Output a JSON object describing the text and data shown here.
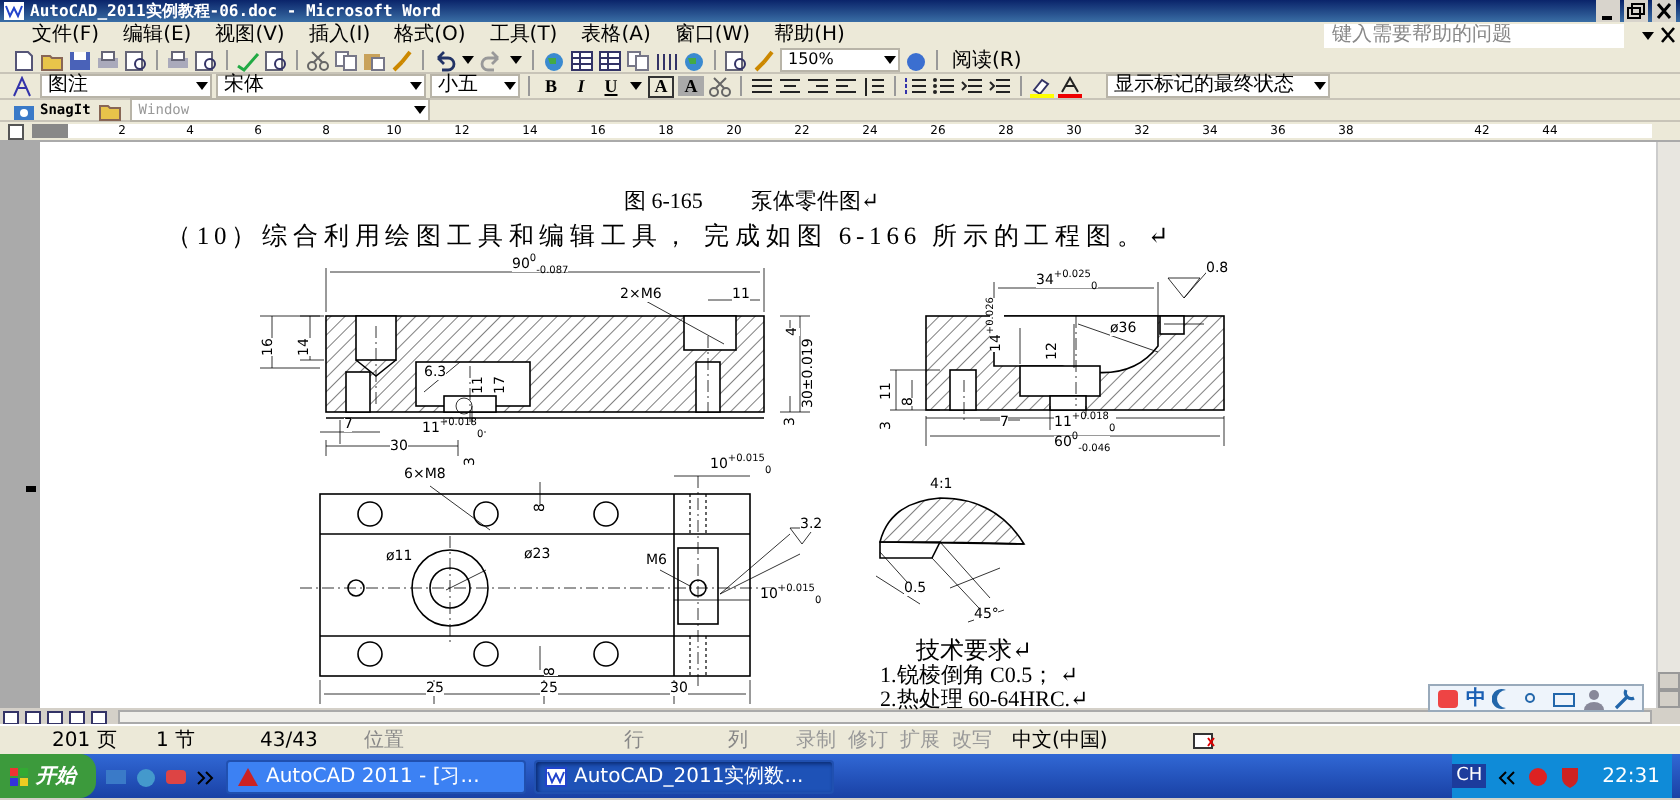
{
  "window": {
    "title": "AutoCAD_2011实例教程-06.doc - Microsoft Word"
  },
  "menu": [
    "文件(F)",
    "编辑(E)",
    "视图(V)",
    "插入(I)",
    "格式(O)",
    "工具(T)",
    "表格(A)",
    "窗口(W)",
    "帮助(H)"
  ],
  "help_box": {
    "placeholder": "键入需要帮助的问题"
  },
  "standard_toolbar": {
    "zoom": "150%",
    "read_button": "阅读(R)"
  },
  "format_toolbar": {
    "style": "图注",
    "font": "宋体",
    "size": "小五",
    "buttons": [
      "B",
      "I",
      "U",
      "A",
      "A"
    ],
    "markup_view": "显示标记的最终状态"
  },
  "snagit_toolbar": {
    "button": "SnagIt",
    "mode": "Window"
  },
  "ruler": {
    "ticks": [
      "2",
      "4",
      "6",
      "8",
      "10",
      "12",
      "14",
      "16",
      "18",
      "20",
      "22",
      "24",
      "26",
      "28",
      "30",
      "32",
      "34",
      "36",
      "38",
      "42",
      "44"
    ]
  },
  "document": {
    "caption_number": "图 6-165",
    "caption_title": "泵体零件图↵",
    "instruction": "（10）综合利用绘图工具和编辑工具， 完成如图 6-166 所示的工程图。↵",
    "figure": {
      "dims": [
        {
          "text": "90$^{0}$$_{-0.087}$",
          "kind": "horizontal"
        },
        {
          "text": "2×M6",
          "kind": "horizontal"
        },
        {
          "text": "11",
          "kind": "horizontal"
        },
        {
          "text": "16",
          "kind": "vertical"
        },
        {
          "text": "14",
          "kind": "vertical"
        },
        {
          "text": "6.3",
          "kind": "horizontal"
        },
        {
          "text": "11",
          "kind": "vertical"
        },
        {
          "text": "17",
          "kind": "vertical"
        },
        {
          "text": "30±0.019",
          "kind": "vertical"
        },
        {
          "text": "4",
          "kind": "vertical"
        },
        {
          "text": "3",
          "kind": "vertical"
        },
        {
          "text": "7",
          "kind": "horizontal"
        },
        {
          "text": "30",
          "kind": "horizontal"
        },
        {
          "text": "11$^{+0.018}$$_{0}$",
          "kind": "horizontal"
        },
        {
          "text": "3",
          "kind": "vertical"
        },
        {
          "text": "0.8",
          "kind": "horizontal"
        },
        {
          "text": "34$^{+0.025}$$_{0}$",
          "kind": "horizontal"
        },
        {
          "text": "14$^{+0.026}$",
          "kind": "vertical"
        },
        {
          "text": "12",
          "kind": "vertical"
        },
        {
          "text": "ø36",
          "kind": "horizontal"
        },
        {
          "text": "11",
          "kind": "vertical"
        },
        {
          "text": "8",
          "kind": "vertical"
        },
        {
          "text": "3",
          "kind": "vertical"
        },
        {
          "text": "7",
          "kind": "horizontal"
        },
        {
          "text": "11$^{+0.018}$$_{0}$",
          "kind": "horizontal"
        },
        {
          "text": "60$^{0}$$_{-0.046}$",
          "kind": "horizontal"
        },
        {
          "text": "6×M8",
          "kind": "horizontal"
        },
        {
          "text": "10$^{+0.015}$$_{0}$",
          "kind": "horizontal"
        },
        {
          "text": "8",
          "kind": "vertical"
        },
        {
          "text": "3.2",
          "kind": "horizontal"
        },
        {
          "text": "ø11",
          "kind": "horizontal"
        },
        {
          "text": "ø23",
          "kind": "horizontal"
        },
        {
          "text": "M6",
          "kind": "horizontal"
        },
        {
          "text": "10$^{+0.015}$$_{0}$",
          "kind": "horizontal"
        },
        {
          "text": "8",
          "kind": "vertical"
        },
        {
          "text": "25",
          "kind": "horizontal"
        },
        {
          "text": "25",
          "kind": "horizontal"
        },
        {
          "text": "30",
          "kind": "horizontal"
        },
        {
          "text": "4:1",
          "kind": "horizontal"
        },
        {
          "text": "0.5",
          "kind": "horizontal"
        },
        {
          "text": "45°",
          "kind": "horizontal"
        }
      ],
      "requirements_title": "技术要求↵",
      "requirements": [
        "1.锐棱倒角 C0.5； ↵",
        "2.热处理 60-64HRC.↵"
      ]
    }
  },
  "status_bar": {
    "page": "201 页",
    "section": "1 节",
    "pages": "43/43",
    "position": "位置",
    "line": "行",
    "column": "列",
    "modes": [
      {
        "label": "录制",
        "on": false
      },
      {
        "label": "修订",
        "on": false
      },
      {
        "label": "扩展",
        "on": false
      },
      {
        "label": "改写",
        "on": false
      }
    ],
    "language": "中文(中国)"
  },
  "ime_bar": {
    "mode": "中"
  },
  "taskbar": {
    "start": "开始",
    "tasks": [
      {
        "label": "AutoCAD 2011 - [习...",
        "selected": false
      },
      {
        "label": "AutoCAD_2011实例数...",
        "selected": true
      }
    ],
    "language": "CH",
    "clock": "22:31"
  }
}
